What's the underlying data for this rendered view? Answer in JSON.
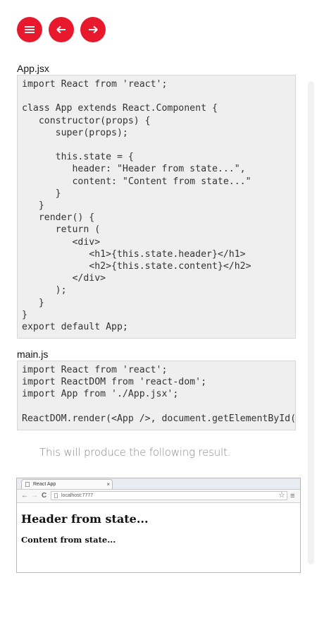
{
  "toolbar": {
    "menu_icon": "menu-icon",
    "back_icon": "arrow-left-icon",
    "forward_icon": "arrow-right-icon",
    "accent_color": "#e8192c"
  },
  "files": [
    {
      "name": "App.jsx",
      "code": "import React from 'react';\n\nclass App extends React.Component {\n   constructor(props) {\n      super(props);\n\n      this.state = {\n         header: \"Header from state...\",\n         content: \"Content from state...\"\n      }\n   }\n   render() {\n      return (\n         <div>\n            <h1>{this.state.header}</h1>\n            <h2>{this.state.content}</h2>\n         </div>\n      );\n   }\n}\nexport default App;"
    },
    {
      "name": "main.js",
      "code": "import React from 'react';\nimport ReactDOM from 'react-dom';\nimport App from './App.jsx';\n\nReactDOM.render(<App />, document.getElementById('app'));"
    }
  ],
  "result_text": "This will produce the following result.",
  "browser": {
    "tab_title": "React App",
    "tab_close": "×",
    "back_glyph": "←",
    "forward_glyph": "→",
    "reload_glyph": "C",
    "url": "localhost:7777",
    "star_glyph": "☆",
    "menu_glyph": "≡",
    "page_h1": "Header from state...",
    "page_h2": "Content from state..."
  }
}
